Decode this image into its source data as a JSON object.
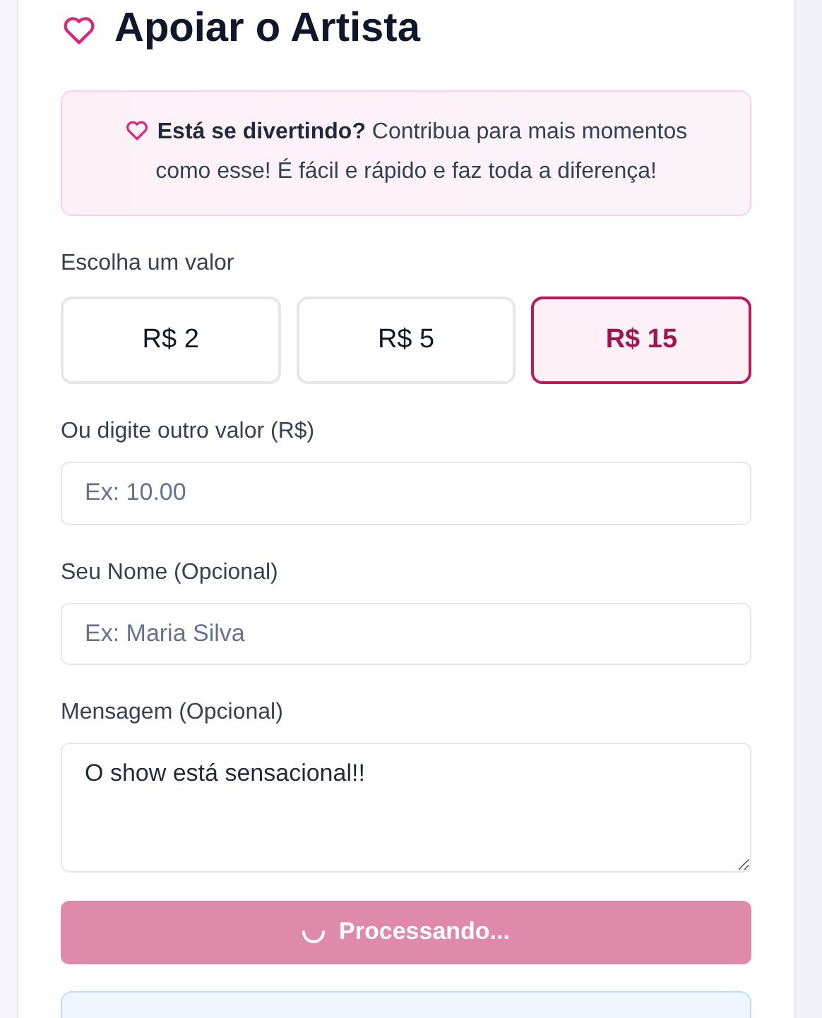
{
  "title": "Apoiar o Artista",
  "notice": {
    "bold": "Está se divertindo?",
    "text": "Contribua para mais momentos como esse! É fácil e rápido e faz toda a diferença!"
  },
  "amount_label": "Escolha um valor",
  "amounts": [
    {
      "label": "R$ 2",
      "selected": false
    },
    {
      "label": "R$ 5",
      "selected": false
    },
    {
      "label": "R$ 15",
      "selected": true
    }
  ],
  "custom_amount": {
    "label": "Ou digite outro valor (R$)",
    "placeholder": "Ex: 10.00"
  },
  "name": {
    "label": "Seu Nome (Opcional)",
    "placeholder": "Ex: Maria Silva"
  },
  "message": {
    "label": "Mensagem (Opcional)",
    "value": "O show está sensacional!!"
  },
  "submit": {
    "label": "Processando...",
    "loading": true
  }
}
